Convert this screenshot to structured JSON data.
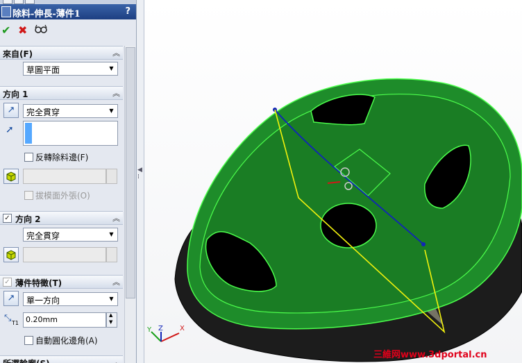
{
  "propertyManager": {
    "title": "除料-伸長-薄件1",
    "help_label": "?",
    "ok_icon": "checkmark-icon",
    "cancel_icon": "x-icon",
    "preview_icon": "glasses-icon",
    "sections": {
      "from": {
        "label": "來自(F)",
        "start_condition": "草圖平面"
      },
      "direction1": {
        "label": "方向 1",
        "end_condition": "完全貫穿",
        "flip_side_to_cut": "反轉除料邊(F)",
        "draft_outward": "拔模面外張(O)"
      },
      "direction2": {
        "label": "方向 2",
        "enabled": true,
        "end_condition": "完全貫穿"
      },
      "thin_feature": {
        "label": "薄件特徵(T)",
        "type": "單一方向",
        "thickness_label": "T1",
        "thickness": "0.20mm",
        "auto_fillet_corners": "自動圓化邊角(A)"
      },
      "selected_contours": {
        "label": "所選輪廓(S)"
      }
    }
  },
  "viewport": {
    "triad_labels": {
      "x": "X",
      "y": "Y",
      "z": "Z"
    },
    "watermark": "三維网www.3dportal.cn",
    "colors": {
      "body_green": "#1e8c2a",
      "edge_green": "#4cff4c",
      "body_dark": "#1c1c1c",
      "sketch_yellow": "#f2f20d",
      "sketch_blue": "#1024b8"
    }
  }
}
